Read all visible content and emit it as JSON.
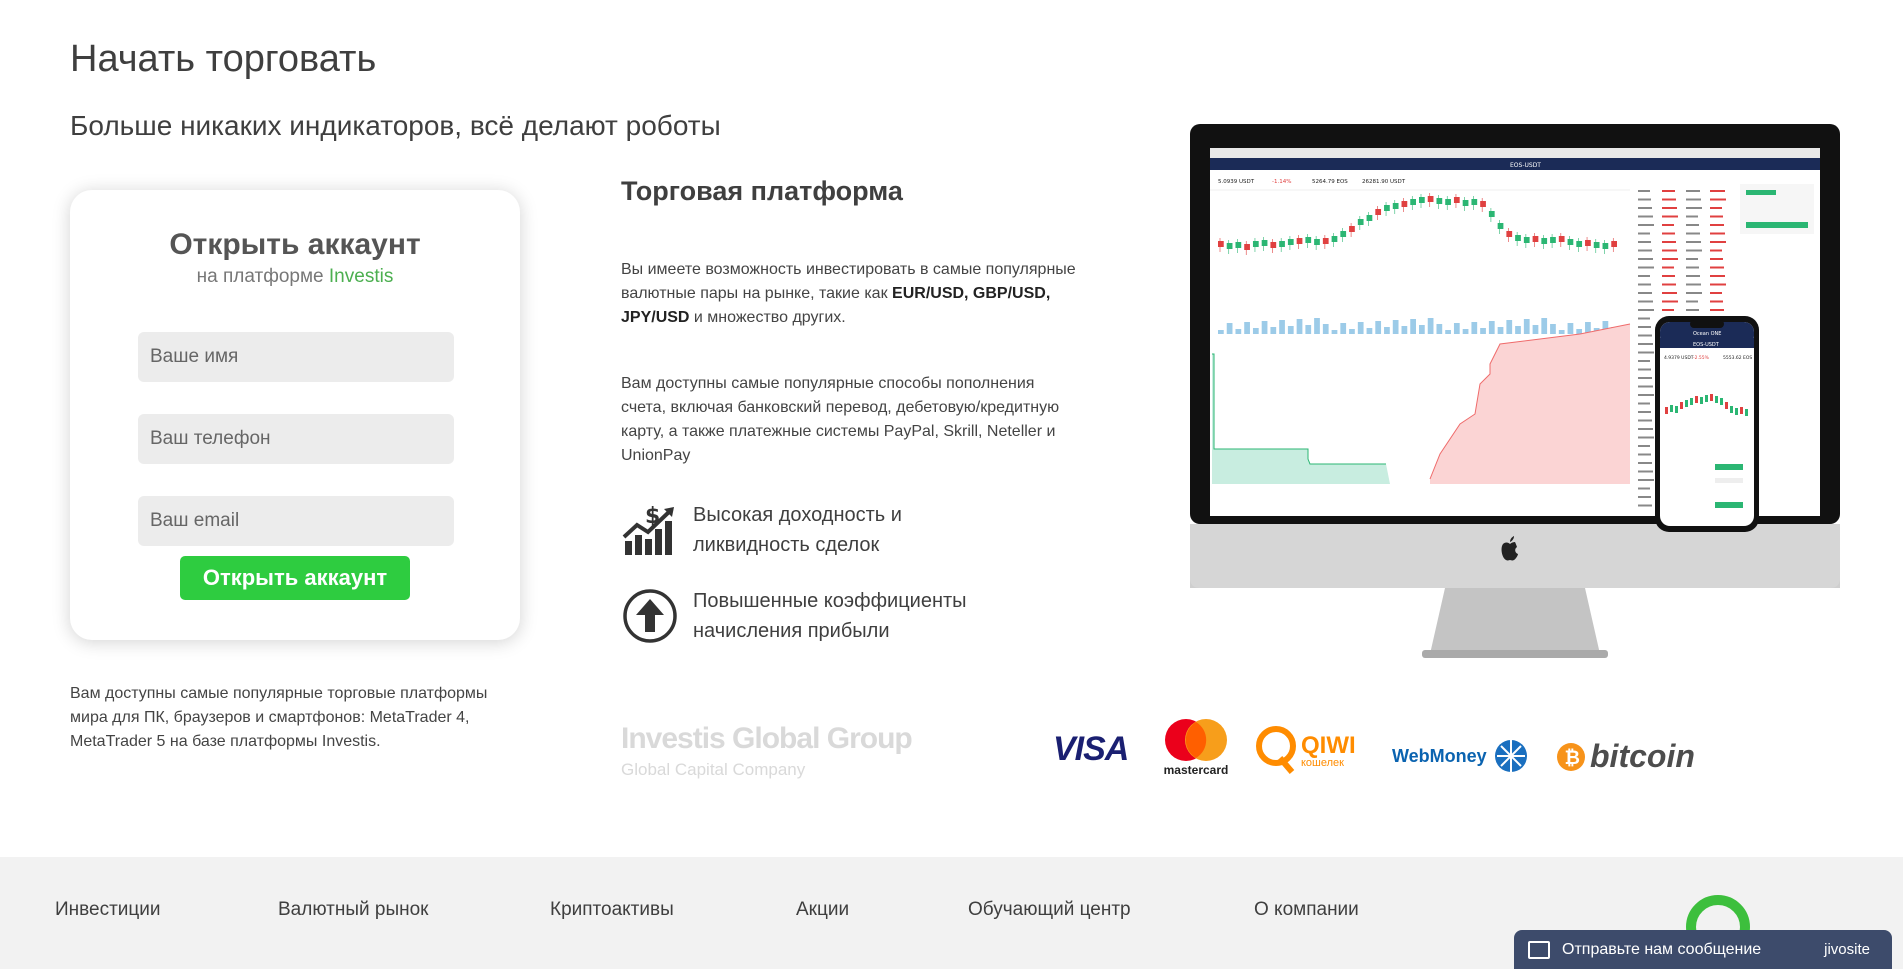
{
  "header": {
    "title": "Начать торговать",
    "subtitle": "Больше никаких индикаторов, всё делают роботы"
  },
  "form": {
    "title": "Открыть аккаунт",
    "subtitle_prefix": "на платформе ",
    "subtitle_brand": "Investis",
    "name_placeholder": "Ваше имя",
    "phone_placeholder": "Ваш телефон",
    "email_placeholder": "Ваш email",
    "submit_label": "Открыть аккаунт"
  },
  "left_note": "Вам доступны самые популярные торговые платформы мира для ПК, браузеров и смартфонов: MetaTrader 4, MetaTrader 5 на базе платформы Investis.",
  "platform": {
    "title": "Торговая платформа",
    "para1_a": "Вы имеете возможность инвестировать в самые популярные валютные пары на рынке, такие как ",
    "para1_bold": "EUR/USD, GBP/USD, JPY/USD",
    "para1_b": " и множество других.",
    "para2": "Вам доступны самые популярные способы пополнения счета, включая банковский перевод, дебетовую/кредитную карту, а также платежные системы PayPal, Skrill, Neteller и UnionPay",
    "features": [
      {
        "icon": "growth-chart-icon",
        "text": "Высокая доходность и ликвидность сделок"
      },
      {
        "icon": "arrow-up-circle-icon",
        "text": "Повышенные коэффициенты начисления прибыли"
      }
    ]
  },
  "company": {
    "name": "Investis Global Group",
    "tagline": "Global Capital Company"
  },
  "payments": {
    "visa": "VISA",
    "mastercard": "mastercard",
    "qiwi": "QIWI",
    "qiwi_sub": "кошелек",
    "webmoney": "WebMoney",
    "bitcoin": "bitcoin"
  },
  "screen": {
    "pair": "EOS-USDT",
    "price1": "5.0939 USDT",
    "change": "-1.14%",
    "vol1": "5264.79 EOS",
    "vol2": "26281.90 USDT",
    "phone_title": "Ocean ONE",
    "phone_pair": "EOS-USDT",
    "phone_price": "4.9379 USDT",
    "phone_change": "-2.55%",
    "phone_vol": "5553.62 EOS"
  },
  "footer": {
    "links": [
      "Инвестиции",
      "Валютный рынок",
      "Криптоактивы",
      "Акции",
      "Обучающий центр",
      "О компании"
    ]
  },
  "chat": {
    "label": "Отправьте нам сообщение",
    "brand": "jivosite"
  },
  "colors": {
    "accent_green": "#2ecc40",
    "brand_green": "#4caf50",
    "chat_bg": "#3d4b6b",
    "footer_bg": "#f2f2f2"
  }
}
